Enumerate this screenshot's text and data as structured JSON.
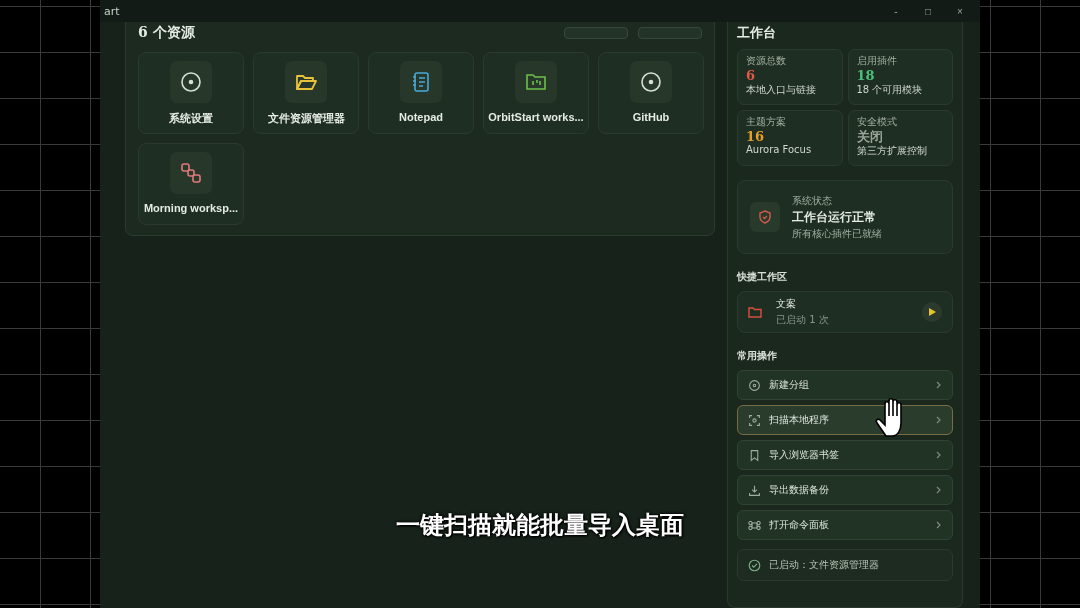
{
  "window": {
    "title": "art",
    "controls": [
      "-",
      "□",
      "×"
    ]
  },
  "resources": {
    "title": "6 个资源",
    "items": [
      {
        "label": "系统设置",
        "kind": "target"
      },
      {
        "label": "文件资源管理器",
        "kind": "folder"
      },
      {
        "label": "Notepad",
        "kind": "notebook"
      },
      {
        "label": "OrbitStart works...",
        "kind": "chart"
      },
      {
        "label": "GitHub",
        "kind": "target"
      },
      {
        "label": "Morning worksp...",
        "kind": "nodes"
      }
    ]
  },
  "workbench": {
    "title": "工作台",
    "stats": [
      {
        "label": "资源总数",
        "value": "6",
        "color": "#e05a4a",
        "note": "本地入口与链接"
      },
      {
        "label": "启用插件",
        "value": "18",
        "color": "#4cc07a",
        "note": "18 个可用模块"
      },
      {
        "label": "主题方案",
        "value": "16",
        "color": "#e8a02a",
        "note": "Aurora Focus"
      },
      {
        "label": "安全模式",
        "value": "关闭",
        "color": "#9aa59a",
        "note": "第三方扩展控制"
      }
    ],
    "status": {
      "label": "系统状态",
      "title": "工作台运行正常",
      "note": "所有核心插件已就绪"
    },
    "quick_title": "快捷工作区",
    "workspace": {
      "name": "文案",
      "note": "已启动 1 次"
    },
    "actions_title": "常用操作",
    "actions": [
      {
        "label": "新建分组",
        "kind": "plus-circle",
        "highlighted": false
      },
      {
        "label": "扫描本地程序",
        "kind": "scan",
        "highlighted": true
      },
      {
        "label": "导入浏览器书签",
        "kind": "bookmark",
        "highlighted": false
      },
      {
        "label": "导出数据备份",
        "kind": "download",
        "highlighted": false
      },
      {
        "label": "打开命令面板",
        "kind": "command",
        "highlighted": false
      }
    ],
    "footer": "已启动：文件资源管理器"
  },
  "caption": "一键扫描就能批量导入桌面"
}
